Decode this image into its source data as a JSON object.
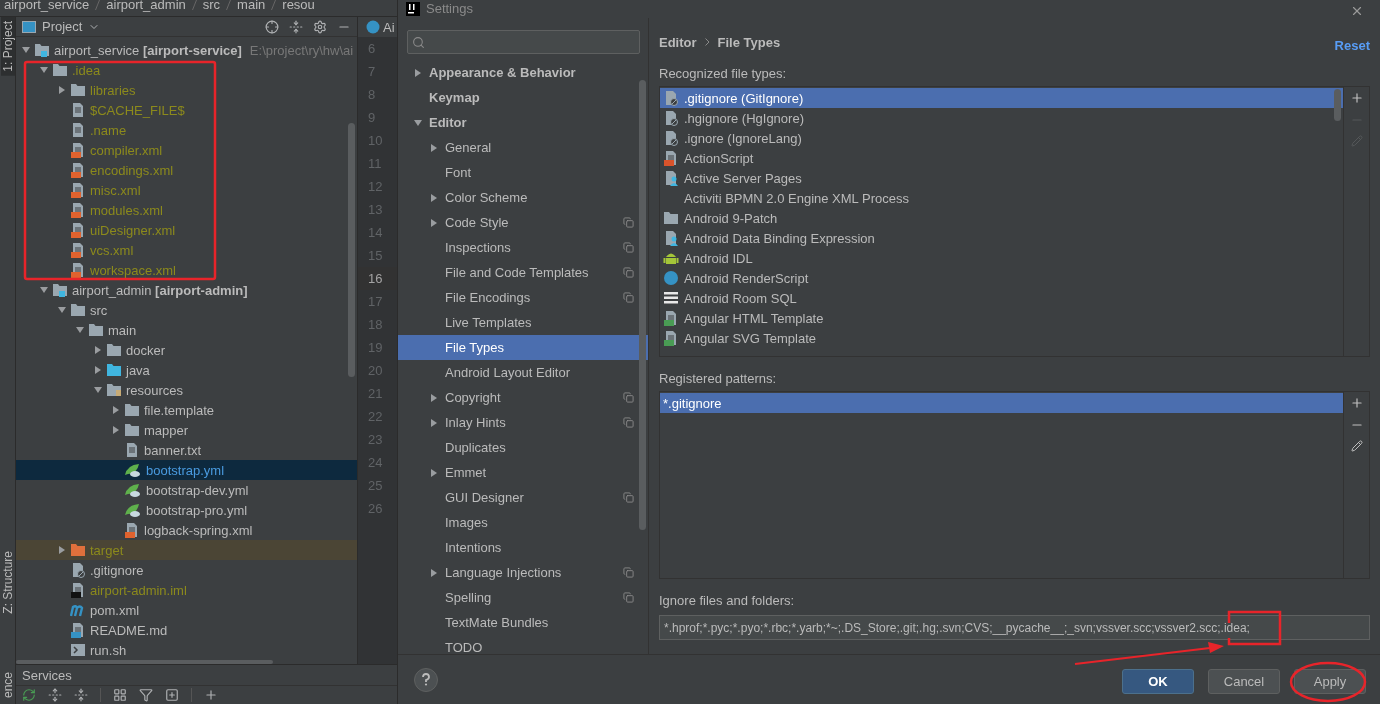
{
  "breadcrumb": [
    "airport_service",
    "airport_admin",
    "src",
    "main",
    "resou"
  ],
  "tool_strip": [
    {
      "label": "1: Project",
      "selected": true
    },
    {
      "label": "Z: Structure",
      "selected": false
    },
    {
      "label": "ence",
      "selected": false
    }
  ],
  "project_panel": {
    "title": "Project",
    "tree": [
      {
        "name": "airport_service **[airport-service]**",
        "path": "E:\\project\\ry\\hw\\ai",
        "kind": "module",
        "ignored": false,
        "selected": false,
        "expanded": true,
        "children": [
          {
            "name": ".idea",
            "kind": "folder",
            "ignored": true,
            "selected": false,
            "expanded": true,
            "children": [
              {
                "name": "libraries",
                "kind": "folder",
                "ignored": true,
                "selected": false,
                "expanded": false
              },
              {
                "name": "$CACHE_FILE$",
                "kind": "text",
                "ignored": true,
                "selected": false
              },
              {
                "name": ".name",
                "kind": "text",
                "ignored": true,
                "selected": false
              },
              {
                "name": "compiler.xml",
                "kind": "xml",
                "ignored": true,
                "selected": false
              },
              {
                "name": "encodings.xml",
                "kind": "xml",
                "ignored": true,
                "selected": false
              },
              {
                "name": "misc.xml",
                "kind": "xml",
                "ignored": true,
                "selected": false
              },
              {
                "name": "modules.xml",
                "kind": "xml",
                "ignored": true,
                "selected": false
              },
              {
                "name": "uiDesigner.xml",
                "kind": "xml",
                "ignored": true,
                "selected": false
              },
              {
                "name": "vcs.xml",
                "kind": "xml",
                "ignored": true,
                "selected": false
              },
              {
                "name": "workspace.xml",
                "kind": "xml",
                "ignored": true,
                "selected": false
              }
            ]
          },
          {
            "name": "airport_admin **[airport-admin]**",
            "kind": "module",
            "ignored": false,
            "selected": false,
            "expanded": true,
            "children": [
              {
                "name": "src",
                "kind": "folder",
                "ignored": false,
                "selected": false,
                "expanded": true,
                "children": [
                  {
                    "name": "main",
                    "kind": "folder",
                    "ignored": false,
                    "selected": false,
                    "expanded": true,
                    "children": [
                      {
                        "name": "docker",
                        "kind": "folder",
                        "ignored": false,
                        "selected": false,
                        "expanded": false
                      },
                      {
                        "name": "java",
                        "kind": "source-folder",
                        "ignored": false,
                        "selected": false,
                        "expanded": false
                      },
                      {
                        "name": "resources",
                        "kind": "resources-folder",
                        "ignored": false,
                        "selected": false,
                        "expanded": true,
                        "children": [
                          {
                            "name": "file.template",
                            "kind": "folder",
                            "ignored": false,
                            "selected": false,
                            "expanded": false
                          },
                          {
                            "name": "mapper",
                            "kind": "folder",
                            "ignored": false,
                            "selected": false,
                            "expanded": false
                          },
                          {
                            "name": "banner.txt",
                            "kind": "text",
                            "ignored": false,
                            "selected": false
                          },
                          {
                            "name": "bootstrap.yml",
                            "kind": "yml",
                            "ignored": false,
                            "selected": true
                          },
                          {
                            "name": "bootstrap-dev.yml",
                            "kind": "yml",
                            "ignored": false,
                            "selected": false
                          },
                          {
                            "name": "bootstrap-pro.yml",
                            "kind": "yml",
                            "ignored": false,
                            "selected": false
                          },
                          {
                            "name": "logback-spring.xml",
                            "kind": "xml",
                            "ignored": false,
                            "selected": false
                          }
                        ]
                      }
                    ]
                  }
                ]
              },
              {
                "name": "target",
                "kind": "excluded-folder",
                "ignored": true,
                "selected": false,
                "expanded": false
              },
              {
                "name": ".gitignore",
                "kind": "ignore",
                "ignored": false,
                "selected": false
              },
              {
                "name": "airport-admin.iml",
                "kind": "iml",
                "ignored": true,
                "selected": false
              },
              {
                "name": "pom.xml",
                "kind": "maven",
                "ignored": false,
                "selected": false
              },
              {
                "name": "README.md",
                "kind": "markdown",
                "ignored": false,
                "selected": false
              },
              {
                "name": "run.sh",
                "kind": "shell",
                "ignored": false,
                "selected": false
              }
            ]
          }
        ]
      }
    ]
  },
  "editor": {
    "tab": "Ai",
    "lines": [
      {
        "number": "6",
        "current": false
      },
      {
        "number": "7",
        "current": false
      },
      {
        "number": "8",
        "current": false
      },
      {
        "number": "9",
        "current": false
      },
      {
        "number": "10",
        "current": false
      },
      {
        "number": "11",
        "current": false
      },
      {
        "number": "12",
        "current": false
      },
      {
        "number": "13",
        "current": false
      },
      {
        "number": "14",
        "current": false
      },
      {
        "number": "15",
        "current": false
      },
      {
        "number": "16",
        "current": true
      },
      {
        "number": "17",
        "current": false
      },
      {
        "number": "18",
        "current": false
      },
      {
        "number": "19",
        "current": false
      },
      {
        "number": "20",
        "current": false
      },
      {
        "number": "21",
        "current": false
      },
      {
        "number": "22",
        "current": false
      },
      {
        "number": "23",
        "current": false
      },
      {
        "number": "24",
        "current": false
      },
      {
        "number": "25",
        "current": false
      },
      {
        "number": "26",
        "current": false
      }
    ]
  },
  "services": {
    "title": "Services"
  },
  "settings": {
    "title": "Settings",
    "nav": [
      {
        "label": "Appearance & Behavior",
        "kind": "group",
        "expanded": false,
        "selected": false
      },
      {
        "label": "Keymap",
        "kind": "page",
        "selected": false
      },
      {
        "label": "Editor",
        "kind": "group",
        "expanded": true,
        "selected": false,
        "children": [
          {
            "label": "General",
            "kind": "group",
            "expanded": false,
            "selected": false,
            "project_scope": false
          },
          {
            "label": "Font",
            "kind": "page",
            "selected": false,
            "project_scope": false
          },
          {
            "label": "Color Scheme",
            "kind": "group",
            "expanded": false,
            "selected": false,
            "project_scope": false
          },
          {
            "label": "Code Style",
            "kind": "group",
            "expanded": false,
            "selected": false,
            "project_scope": true
          },
          {
            "label": "Inspections",
            "kind": "page",
            "selected": false,
            "project_scope": true
          },
          {
            "label": "File and Code Templates",
            "kind": "page",
            "selected": false,
            "project_scope": true
          },
          {
            "label": "File Encodings",
            "kind": "page",
            "selected": false,
            "project_scope": true
          },
          {
            "label": "Live Templates",
            "kind": "page",
            "selected": false,
            "project_scope": false
          },
          {
            "label": "File Types",
            "kind": "page",
            "selected": true,
            "project_scope": false
          },
          {
            "label": "Android Layout Editor",
            "kind": "page",
            "selected": false,
            "project_scope": false
          },
          {
            "label": "Copyright",
            "kind": "group",
            "expanded": false,
            "selected": false,
            "project_scope": true
          },
          {
            "label": "Inlay Hints",
            "kind": "group",
            "expanded": false,
            "selected": false,
            "project_scope": true
          },
          {
            "label": "Duplicates",
            "kind": "page",
            "selected": false,
            "project_scope": false
          },
          {
            "label": "Emmet",
            "kind": "group",
            "expanded": false,
            "selected": false,
            "project_scope": false
          },
          {
            "label": "GUI Designer",
            "kind": "page",
            "selected": false,
            "project_scope": true
          },
          {
            "label": "Images",
            "kind": "page",
            "selected": false,
            "project_scope": false
          },
          {
            "label": "Intentions",
            "kind": "page",
            "selected": false,
            "project_scope": false
          },
          {
            "label": "Language Injections",
            "kind": "group",
            "expanded": false,
            "selected": false,
            "project_scope": true
          },
          {
            "label": "Spelling",
            "kind": "page",
            "selected": false,
            "project_scope": true
          },
          {
            "label": "TextMate Bundles",
            "kind": "page",
            "selected": false,
            "project_scope": false
          },
          {
            "label": "TODO",
            "kind": "page",
            "selected": false,
            "project_scope": false
          }
        ]
      }
    ],
    "breadcrumb": [
      "Editor",
      "File Types"
    ],
    "reset": "Reset",
    "recognized": {
      "label": "Recognized file types:",
      "items": [
        {
          "label": ".gitignore (GitIgnore)",
          "kind": "ignore",
          "selected": true
        },
        {
          "label": ".hgignore (HgIgnore)",
          "kind": "ignore",
          "selected": false
        },
        {
          "label": ".ignore (IgnoreLang)",
          "kind": "ignore",
          "selected": false
        },
        {
          "label": "ActionScript",
          "kind": "actionscript",
          "selected": false
        },
        {
          "label": "Active Server Pages",
          "kind": "person",
          "selected": false
        },
        {
          "label": "Activiti BPMN 2.0 Engine XML Process",
          "kind": "none",
          "selected": false
        },
        {
          "label": "Android 9-Patch",
          "kind": "folder",
          "selected": false
        },
        {
          "label": "Android Data Binding Expression",
          "kind": "person",
          "selected": false
        },
        {
          "label": "Android IDL",
          "kind": "android",
          "selected": false
        },
        {
          "label": "Android RenderScript",
          "kind": "circle",
          "selected": false
        },
        {
          "label": "Android Room SQL",
          "kind": "lines",
          "selected": false
        },
        {
          "label": "Angular HTML Template",
          "kind": "angular",
          "selected": false
        },
        {
          "label": "Angular SVG Template",
          "kind": "angular",
          "selected": false
        }
      ],
      "toolbar": [
        {
          "kind": "add",
          "disabled": false
        },
        {
          "kind": "remove",
          "disabled": true
        },
        {
          "kind": "edit",
          "disabled": true
        }
      ]
    },
    "patterns": {
      "label": "Registered patterns:",
      "items": [
        {
          "label": "*.gitignore",
          "selected": true
        }
      ],
      "toolbar": [
        {
          "kind": "add",
          "disabled": false
        },
        {
          "kind": "remove",
          "disabled": false
        },
        {
          "kind": "edit",
          "disabled": false
        }
      ]
    },
    "ignore": {
      "label": "Ignore files and folders:",
      "value": "*.hprof;*.pyc;*.pyo;*.rbc;*.yarb;*~;.DS_Store;.git;.hg;.svn;CVS;__pycache__;_svn;vssver.scc;vssver2.scc;.idea;"
    },
    "buttons": [
      {
        "label": "OK",
        "default": true
      },
      {
        "label": "Cancel",
        "default": false
      },
      {
        "label": "Apply",
        "default": false
      }
    ]
  }
}
